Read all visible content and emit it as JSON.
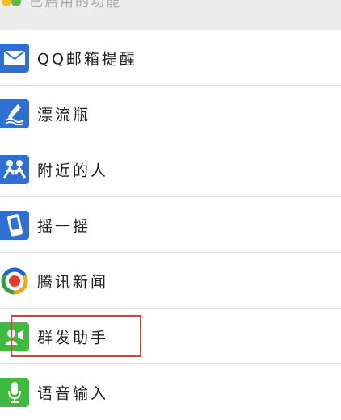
{
  "section_header": {
    "label": "已启用的功能"
  },
  "features": [
    {
      "label": "QQ邮箱提醒",
      "icon": "mail-icon",
      "color": "#2f6fd2"
    },
    {
      "label": "漂流瓶",
      "icon": "drift-bottle-icon",
      "color": "#2f6fd2"
    },
    {
      "label": "附近的人",
      "icon": "people-nearby-icon",
      "color": "#2f6fd2"
    },
    {
      "label": "摇一摇",
      "icon": "shake-icon",
      "color": "#2f6fd2"
    },
    {
      "label": "腾讯新闻",
      "icon": "tencent-news-icon",
      "color": "#e8a317"
    },
    {
      "label": "群发助手",
      "icon": "broadcast-assistant-icon",
      "color": "#3fb93f"
    },
    {
      "label": "语音输入",
      "icon": "microphone-icon",
      "color": "#3fb93f"
    }
  ],
  "highlight": {
    "target": "群发助手",
    "color": "#e33a3a"
  }
}
